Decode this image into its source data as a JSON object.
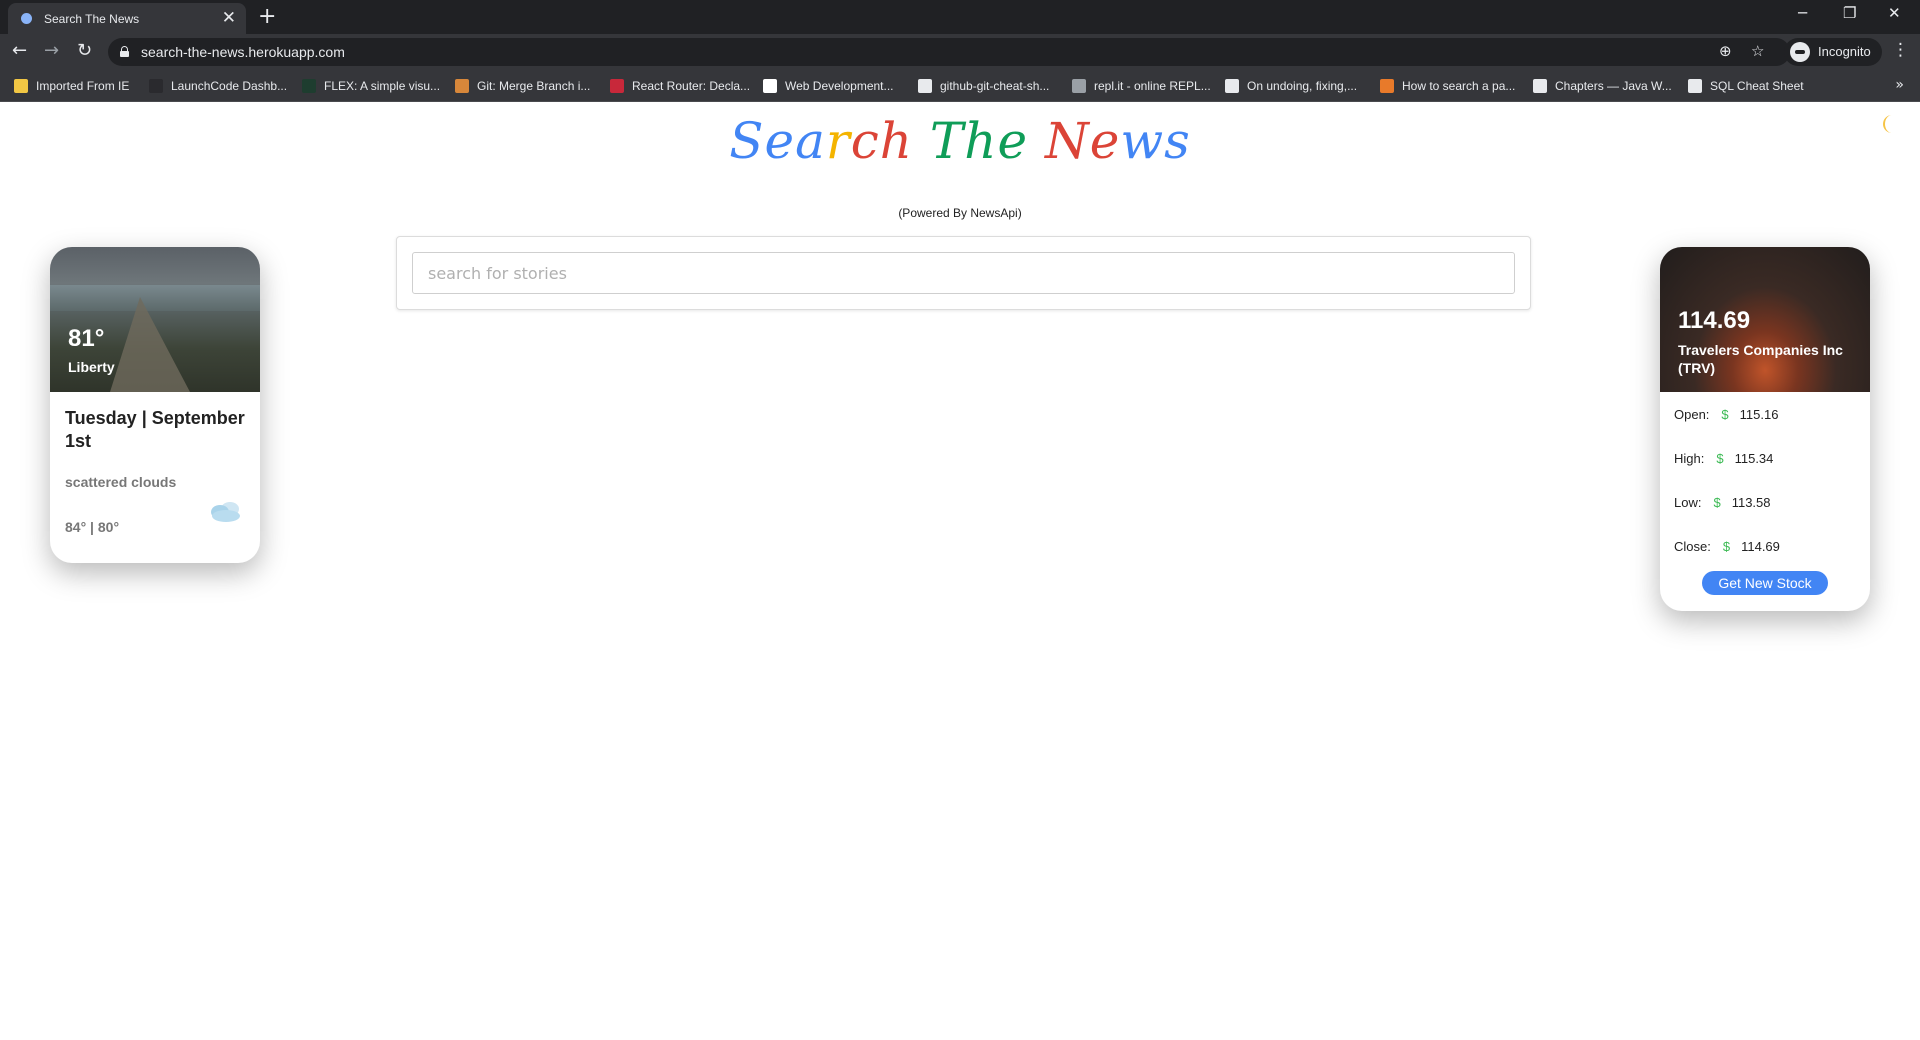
{
  "browser": {
    "tab_title": "Search The News",
    "tab_close": "✕",
    "new_tab": "+",
    "window_buttons": {
      "minimize": "─",
      "restore": "❐",
      "close": "✕"
    },
    "nav": {
      "back": "←",
      "forward": "→",
      "reload": "↻"
    },
    "url": "search-the-news.herokuapp.com",
    "omnibox_icons": {
      "location": "⊕",
      "star": "☆"
    },
    "profile_label": "Incognito",
    "menu": "⋮",
    "bookmarks": [
      {
        "label": "Imported From IE",
        "icon_color": "#f2c744"
      },
      {
        "label": "LaunchCode Dashb...",
        "icon_color": "#2a2a2e"
      },
      {
        "label": "FLEX: A simple visu...",
        "icon_color": "#1e3d2f"
      },
      {
        "label": "Git: Merge Branch i...",
        "icon_color": "#d7873a"
      },
      {
        "label": "React Router: Decla...",
        "icon_color": "#c8283a"
      },
      {
        "label": "Web Development...",
        "icon_color": "#ffffff"
      },
      {
        "label": "github-git-cheat-sh...",
        "icon_color": "#e8eaed"
      },
      {
        "label": "repl.it - online REPL...",
        "icon_color": "#9aa0a6"
      },
      {
        "label": "On undoing, fixing,...",
        "icon_color": "#e8eaed"
      },
      {
        "label": "How to search a pa...",
        "icon_color": "#e87a2a"
      },
      {
        "label": "Chapters — Java W...",
        "icon_color": "#e8eaed"
      },
      {
        "label": "SQL Cheat Sheet",
        "icon_color": "#e8eaed"
      }
    ],
    "bookmarks_overflow": "»"
  },
  "page": {
    "logo": {
      "letters": [
        {
          "ch": "S",
          "color": "#4285f4"
        },
        {
          "ch": "e",
          "color": "#4285f4"
        },
        {
          "ch": "a",
          "color": "#4285f4"
        },
        {
          "ch": "r",
          "color": "#f4b400"
        },
        {
          "ch": "c",
          "color": "#db4437"
        },
        {
          "ch": "h",
          "color": "#db4437"
        },
        {
          "ch": " ",
          "color": "#ffffff"
        },
        {
          "ch": "T",
          "color": "#0f9d58"
        },
        {
          "ch": "h",
          "color": "#0f9d58"
        },
        {
          "ch": "e",
          "color": "#0f9d58"
        },
        {
          "ch": " ",
          "color": "#ffffff"
        },
        {
          "ch": "N",
          "color": "#db4437"
        },
        {
          "ch": "e",
          "color": "#db4437"
        },
        {
          "ch": "w",
          "color": "#4285f4"
        },
        {
          "ch": "s",
          "color": "#4285f4"
        }
      ]
    },
    "powered_by": "(Powered By NewsApi)",
    "search": {
      "placeholder": "search for stories",
      "value": ""
    },
    "dark_mode_icon": "moon",
    "weather": {
      "temp": "81°",
      "city": "Liberty",
      "date": "Tuesday | September 1st",
      "description": "scattered clouds",
      "range": "84° | 80°",
      "icon": "cloud"
    },
    "stock": {
      "price": "114.69",
      "name": "Travelers Companies Inc (TRV)",
      "currency": "$",
      "rows": [
        {
          "label": "Open:",
          "value": "115.16"
        },
        {
          "label": "High:",
          "value": "115.34"
        },
        {
          "label": "Low:",
          "value": "113.58"
        },
        {
          "label": "Close:",
          "value": "114.69"
        }
      ],
      "button_label": "Get New Stock",
      "accent_color": "#4285f4",
      "dollar_color": "#3cba54"
    }
  }
}
